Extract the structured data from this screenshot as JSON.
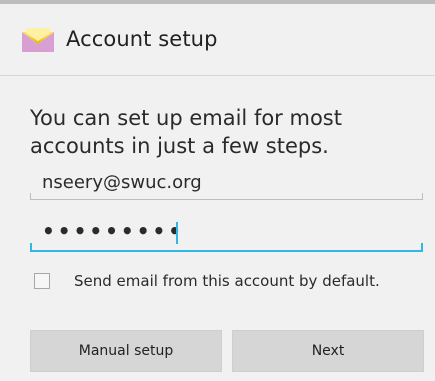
{
  "colors": {
    "accent": "#33b5e5",
    "background": "#f1f1f1",
    "button": "#d6d6d6"
  },
  "app": {
    "title": "Account setup",
    "icon": "envelope-icon"
  },
  "form": {
    "intro": "You can set up email for most accounts in just a few steps.",
    "email_value": "nseery@swuc.org",
    "password_value": "•••••••••",
    "default_label": "Send email from this account by default.",
    "default_checked": false
  },
  "buttons": {
    "manual_setup": "Manual setup",
    "next": "Next"
  }
}
